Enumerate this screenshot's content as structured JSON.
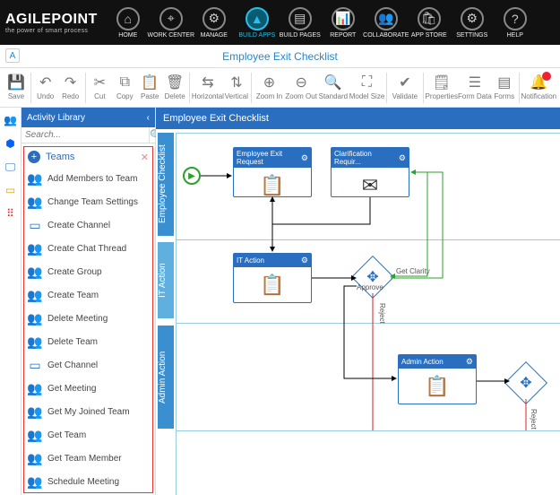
{
  "brand": {
    "title": "AGILEPOINT",
    "sub": "the power of smart process"
  },
  "nav": {
    "items": [
      {
        "label": "HOME",
        "glyph": "⌂"
      },
      {
        "label": "WORK CENTER",
        "glyph": "⌖"
      },
      {
        "label": "MANAGE",
        "glyph": "⚙"
      },
      {
        "label": "BUILD APPS",
        "glyph": "▲",
        "active": true
      },
      {
        "label": "BUILD PAGES",
        "glyph": "▤"
      },
      {
        "label": "REPORT",
        "glyph": "📊"
      },
      {
        "label": "COLLABORATE",
        "glyph": "👥"
      },
      {
        "label": "APP STORE",
        "glyph": "🛍"
      },
      {
        "label": "SETTINGS",
        "glyph": "⚙"
      },
      {
        "label": "HELP",
        "glyph": "?"
      }
    ]
  },
  "titlebar": {
    "title": "Employee Exit Checklist",
    "corner": "A"
  },
  "toolbar": {
    "items": [
      {
        "key": "save",
        "label": "Save",
        "glyph": "💾"
      },
      {
        "sep": true
      },
      {
        "key": "undo",
        "label": "Undo",
        "glyph": "↶"
      },
      {
        "key": "redo",
        "label": "Redo",
        "glyph": "↷"
      },
      {
        "sep": true
      },
      {
        "key": "cut",
        "label": "Cut",
        "glyph": "✂"
      },
      {
        "key": "copy",
        "label": "Copy",
        "glyph": "⧉"
      },
      {
        "key": "paste",
        "label": "Paste",
        "glyph": "📋"
      },
      {
        "key": "delete",
        "label": "Delete",
        "glyph": "🗑"
      },
      {
        "sep": true
      },
      {
        "key": "horizontal",
        "label": "Horizontal",
        "glyph": "⇆",
        "wide": true
      },
      {
        "key": "vertical",
        "label": "Vertical",
        "glyph": "⇅"
      },
      {
        "sep": true
      },
      {
        "key": "zoomin",
        "label": "Zoom In",
        "glyph": "⊕",
        "wide": true
      },
      {
        "key": "zoomout",
        "label": "Zoom Out",
        "glyph": "⊖",
        "wide": true
      },
      {
        "key": "standard",
        "label": "Standard",
        "glyph": "🔍",
        "wide": true
      },
      {
        "key": "modelsize",
        "label": "Model Size",
        "glyph": "⛶",
        "wide": true
      },
      {
        "sep": true
      },
      {
        "key": "validate",
        "label": "Validate",
        "glyph": "✔",
        "wide": true
      },
      {
        "sep": true
      },
      {
        "key": "properties",
        "label": "Properties",
        "glyph": "🗒",
        "wide": true
      },
      {
        "key": "formdata",
        "label": "Form Data",
        "glyph": "☰",
        "wide": true
      },
      {
        "key": "forms",
        "label": "Forms",
        "glyph": "▤"
      },
      {
        "sep": true
      },
      {
        "key": "notification",
        "label": "Notification",
        "glyph": "🔔",
        "wide": true,
        "badge": true
      }
    ]
  },
  "leftrail": [
    {
      "name": "teams",
      "glyph": "👥",
      "color": "#5059c9"
    },
    {
      "name": "dropbox",
      "glyph": "⬢",
      "color": "#0061ff"
    },
    {
      "name": "monitor",
      "glyph": "🖵",
      "color": "#2a6fbf"
    },
    {
      "name": "window",
      "glyph": "▭",
      "color": "#e6a100"
    },
    {
      "name": "flow",
      "glyph": "⠿",
      "color": "#e23"
    }
  ],
  "sidebar": {
    "header": "Activity Library",
    "search_placeholder": "Search...",
    "group": "Teams",
    "items": [
      {
        "label": "Add Members to Team",
        "icon": "👥"
      },
      {
        "label": "Change Team Settings",
        "icon": "👥"
      },
      {
        "label": "Create Channel",
        "icon": "–"
      },
      {
        "label": "Create Chat Thread",
        "icon": "👥"
      },
      {
        "label": "Create Group",
        "icon": "👥"
      },
      {
        "label": "Create Team",
        "icon": "👥"
      },
      {
        "label": "Delete Meeting",
        "icon": "👥"
      },
      {
        "label": "Delete Team",
        "icon": "👥"
      },
      {
        "label": "Get Channel",
        "icon": "–"
      },
      {
        "label": "Get Meeting",
        "icon": "👥"
      },
      {
        "label": "Get My Joined Team",
        "icon": "👥"
      },
      {
        "label": "Get Team",
        "icon": "👥"
      },
      {
        "label": "Get Team Member",
        "icon": "👥"
      },
      {
        "label": "Schedule Meeting",
        "icon": "👥"
      }
    ]
  },
  "canvas": {
    "tab": "Employee Exit Checklist",
    "lanes": [
      {
        "label": "Employee Checklist"
      },
      {
        "label": "IT Action"
      },
      {
        "label": "Admin Action"
      }
    ],
    "nodes": {
      "n1": {
        "title": "Employee Exit Request",
        "glyph": "📋"
      },
      "n2": {
        "title": "Clarification Requir...",
        "glyph": "✉"
      },
      "n3": {
        "title": "IT Action",
        "glyph": "📋"
      },
      "n4": {
        "title": "Admin Action",
        "glyph": "📋"
      }
    },
    "gateways": {
      "g1": {
        "approve": "Approve",
        "reject": "Reject",
        "extra": "Get Clarity"
      },
      "g2": {
        "reject": "Reject"
      }
    }
  }
}
